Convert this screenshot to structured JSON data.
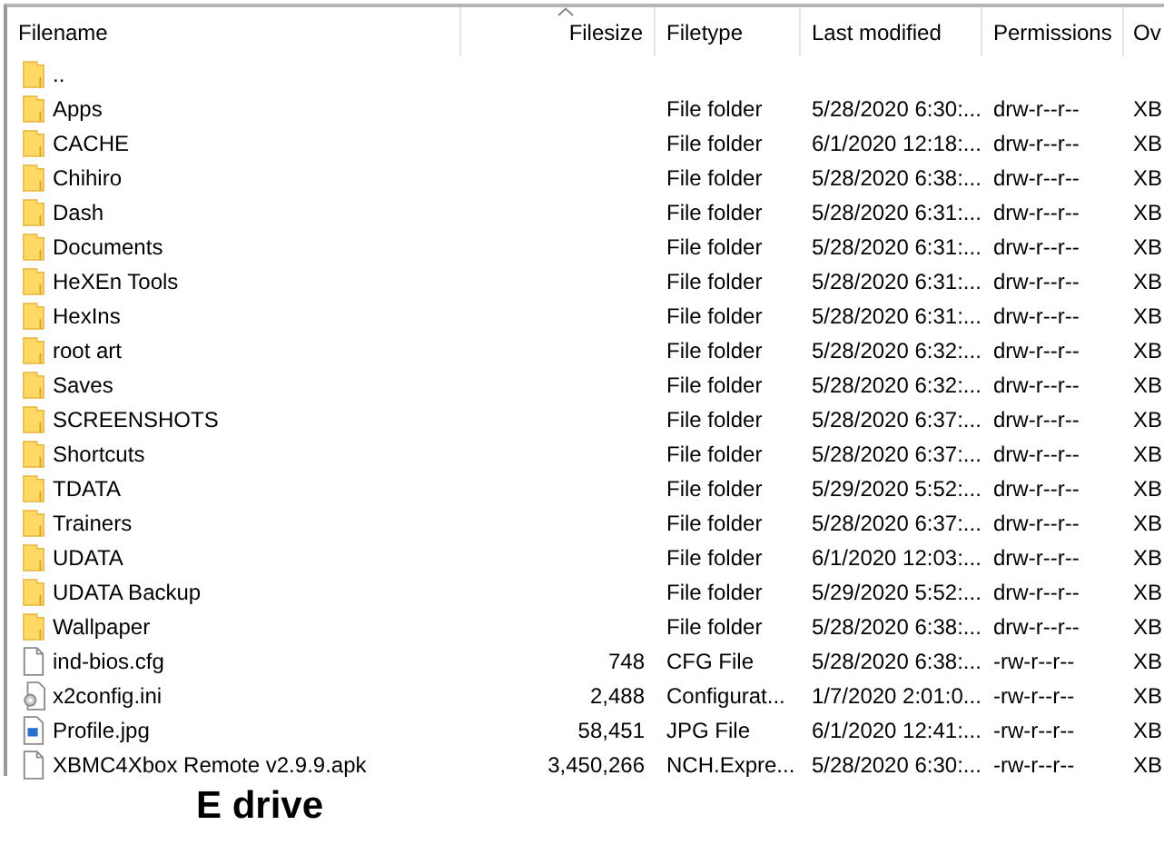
{
  "columns": [
    {
      "label": "Filename",
      "sorted": false
    },
    {
      "label": "Filesize",
      "sorted": true
    },
    {
      "label": "Filetype",
      "sorted": false
    },
    {
      "label": "Last modified",
      "sorted": false
    },
    {
      "label": "Permissions",
      "sorted": false
    },
    {
      "label": "Ov",
      "sorted": false
    }
  ],
  "rows": [
    {
      "kind": "folder",
      "name": ".."
    },
    {
      "kind": "folder",
      "name": "Apps",
      "type": "File folder",
      "modified": "5/28/2020 6:30:...",
      "permissions": "drw-r--r--",
      "owner": "XB"
    },
    {
      "kind": "folder",
      "name": "CACHE",
      "type": "File folder",
      "modified": "6/1/2020 12:18:...",
      "permissions": "drw-r--r--",
      "owner": "XB"
    },
    {
      "kind": "folder",
      "name": "Chihiro",
      "type": "File folder",
      "modified": "5/28/2020 6:38:...",
      "permissions": "drw-r--r--",
      "owner": "XB"
    },
    {
      "kind": "folder",
      "name": "Dash",
      "type": "File folder",
      "modified": "5/28/2020 6:31:...",
      "permissions": "drw-r--r--",
      "owner": "XB"
    },
    {
      "kind": "folder",
      "name": "Documents",
      "type": "File folder",
      "modified": "5/28/2020 6:31:...",
      "permissions": "drw-r--r--",
      "owner": "XB"
    },
    {
      "kind": "folder",
      "name": "HeXEn Tools",
      "type": "File folder",
      "modified": "5/28/2020 6:31:...",
      "permissions": "drw-r--r--",
      "owner": "XB"
    },
    {
      "kind": "folder",
      "name": "HexIns",
      "type": "File folder",
      "modified": "5/28/2020 6:31:...",
      "permissions": "drw-r--r--",
      "owner": "XB"
    },
    {
      "kind": "folder",
      "name": "root art",
      "type": "File folder",
      "modified": "5/28/2020 6:32:...",
      "permissions": "drw-r--r--",
      "owner": "XB"
    },
    {
      "kind": "folder",
      "name": "Saves",
      "type": "File folder",
      "modified": "5/28/2020 6:32:...",
      "permissions": "drw-r--r--",
      "owner": "XB"
    },
    {
      "kind": "folder",
      "name": "SCREENSHOTS",
      "type": "File folder",
      "modified": "5/28/2020 6:37:...",
      "permissions": "drw-r--r--",
      "owner": "XB"
    },
    {
      "kind": "folder",
      "name": "Shortcuts",
      "type": "File folder",
      "modified": "5/28/2020 6:37:...",
      "permissions": "drw-r--r--",
      "owner": "XB"
    },
    {
      "kind": "folder",
      "name": "TDATA",
      "type": "File folder",
      "modified": "5/29/2020 5:52:...",
      "permissions": "drw-r--r--",
      "owner": "XB"
    },
    {
      "kind": "folder",
      "name": "Trainers",
      "type": "File folder",
      "modified": "5/28/2020 6:37:...",
      "permissions": "drw-r--r--",
      "owner": "XB"
    },
    {
      "kind": "folder",
      "name": "UDATA",
      "type": "File folder",
      "modified": "6/1/2020 12:03:...",
      "permissions": "drw-r--r--",
      "owner": "XB"
    },
    {
      "kind": "folder",
      "name": "UDATA Backup",
      "type": "File folder",
      "modified": "5/29/2020 5:52:...",
      "permissions": "drw-r--r--",
      "owner": "XB"
    },
    {
      "kind": "folder",
      "name": "Wallpaper",
      "type": "File folder",
      "modified": "5/28/2020 6:38:...",
      "permissions": "drw-r--r--",
      "owner": "XB"
    },
    {
      "kind": "file",
      "name": "ind-bios.cfg",
      "size": "748",
      "type": "CFG File",
      "modified": "5/28/2020 6:38:...",
      "permissions": "-rw-r--r--",
      "owner": "XB"
    },
    {
      "kind": "config",
      "name": "x2config.ini",
      "size": "2,488",
      "type": "Configurat...",
      "modified": "1/7/2020 2:01:0...",
      "permissions": "-rw-r--r--",
      "owner": "XB"
    },
    {
      "kind": "image",
      "name": "Profile.jpg",
      "size": "58,451",
      "type": "JPG File",
      "modified": "6/1/2020 12:41:...",
      "permissions": "-rw-r--r--",
      "owner": "XB"
    },
    {
      "kind": "file",
      "name": "XBMC4Xbox Remote v2.9.9.apk",
      "size": "3,450,266",
      "type": "NCH.Expre...",
      "modified": "5/28/2020 6:30:...",
      "permissions": "-rw-r--r--",
      "owner": "XB"
    }
  ],
  "caption": "E drive"
}
